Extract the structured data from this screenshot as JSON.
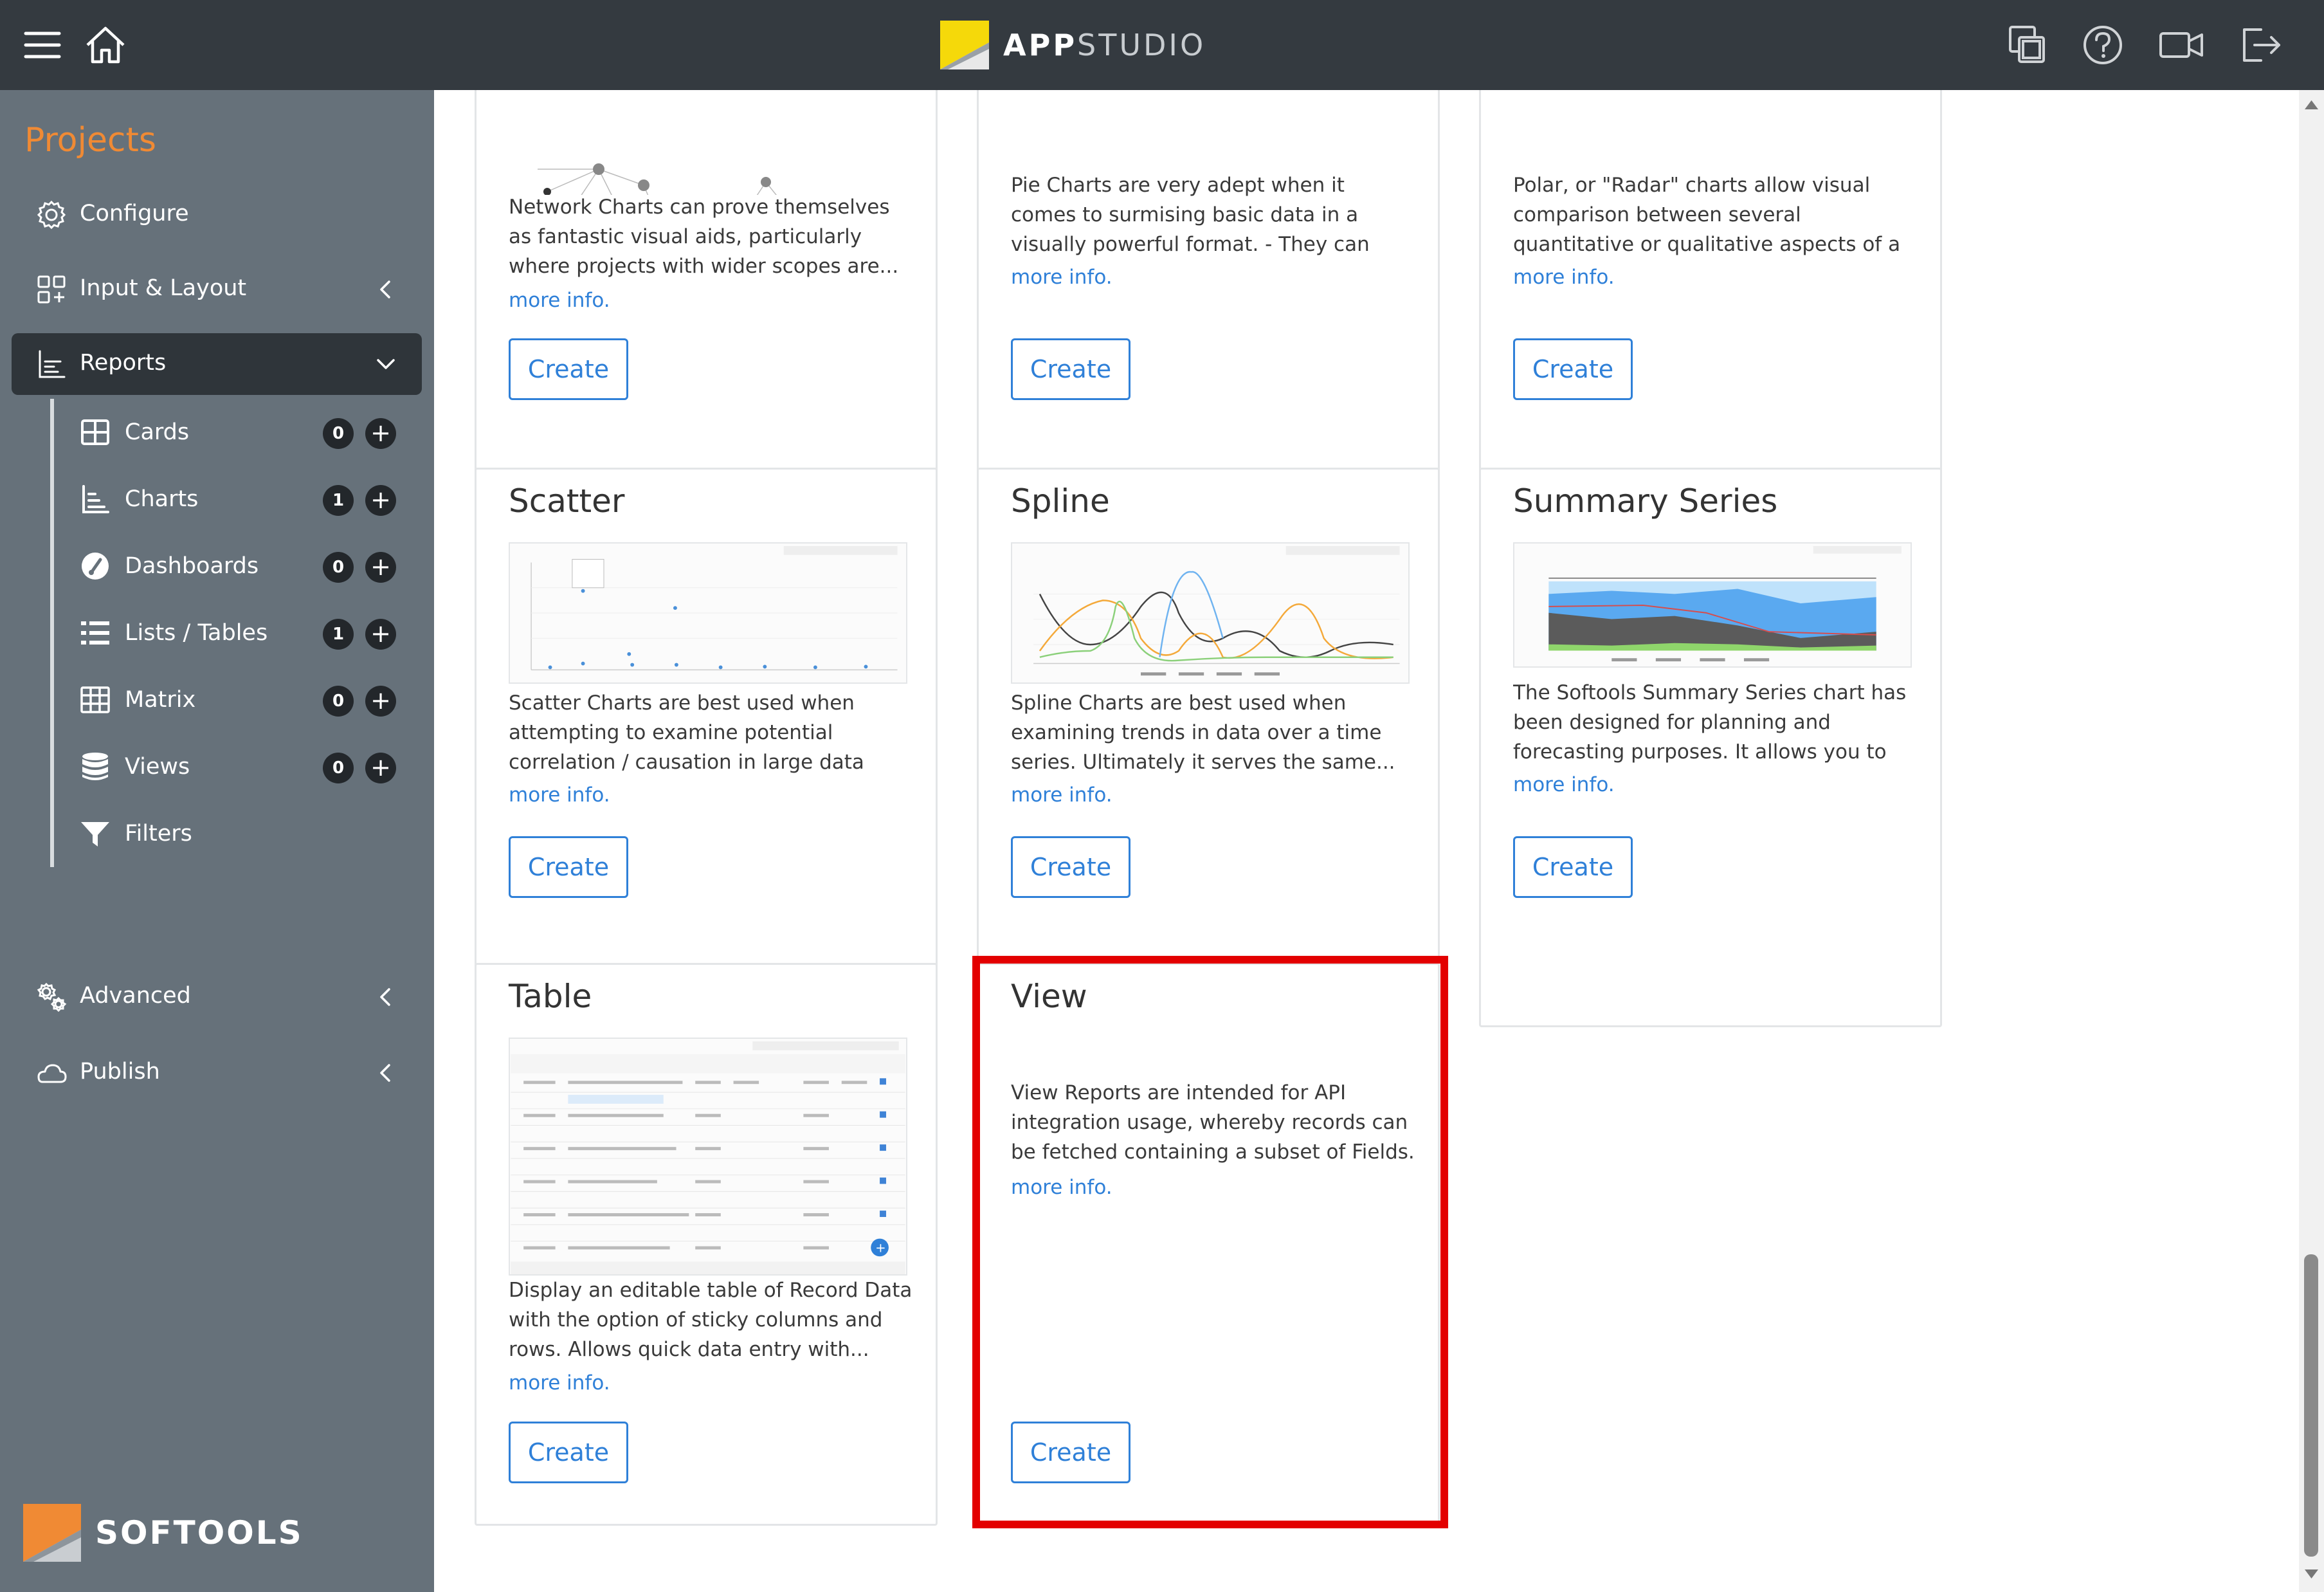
{
  "app": {
    "brand_bold": "APP",
    "brand_light": "STUDIO",
    "footer_brand": "SOFTOOLS",
    "accent_color": "#f08a34",
    "link_color": "#2f80d8",
    "highlight_color": "#e30000"
  },
  "topbar": {
    "left_icons": [
      "hamburger-menu-icon",
      "home-icon"
    ],
    "right_icons": [
      "copy-window-icon",
      "help-icon",
      "video-icon",
      "logout-icon"
    ]
  },
  "sidebar": {
    "title": "Projects",
    "items": [
      {
        "label": "Configure",
        "icon": "gear-icon"
      },
      {
        "label": "Input & Layout",
        "icon": "layout-grid-icon"
      },
      {
        "label": "Reports",
        "icon": "chart-icon"
      },
      {
        "label": "Advanced",
        "icon": "gears-icon"
      },
      {
        "label": "Publish",
        "icon": "cloud-icon"
      }
    ],
    "reports_children": [
      {
        "label": "Cards",
        "count": "0",
        "icon": "cards-icon"
      },
      {
        "label": "Charts",
        "count": "1",
        "icon": "chart-icon"
      },
      {
        "label": "Dashboards",
        "count": "0",
        "icon": "dashboard-gauge-icon"
      },
      {
        "label": "Lists / Tables",
        "count": "1",
        "icon": "list-icon"
      },
      {
        "label": "Matrix",
        "count": "0",
        "icon": "matrix-icon"
      },
      {
        "label": "Views",
        "count": "0",
        "icon": "database-icon"
      },
      {
        "label": "Filters",
        "icon": "filter-icon"
      }
    ],
    "add_symbol": "+"
  },
  "cards": [
    {
      "title": "",
      "desc": "Network Charts can prove themselves as fantastic visual aids, particularly where projects with wider scopes are...",
      "more": "more info.",
      "button": "Create"
    },
    {
      "title": "",
      "desc": "Pie Charts are very adept when it comes to surmising basic data in a visually powerful format. - They can also prove ...",
      "more": "more info.",
      "button": "Create"
    },
    {
      "title": "",
      "desc": "Polar, or \"Radar\" charts allow visual comparison between several quantitative or qualitative aspects of a scenario.Or...",
      "more": "more info.",
      "button": "Create"
    },
    {
      "title": "Scatter",
      "desc": "Scatter Charts are best used when attempting to examine potential correlation / causation in large data set...",
      "more": "more info.",
      "button": "Create"
    },
    {
      "title": "Spline",
      "desc": "Spline Charts are best used when examining trends in data over a time series. Ultimately it serves the same...",
      "more": "more info.",
      "button": "Create"
    },
    {
      "title": "Summary Series",
      "desc": "The Softools Summary Series chart has been designed for planning and forecasting purposes. It allows you to pl...",
      "more": "more info.",
      "button": "Create"
    },
    {
      "title": "Table",
      "desc": "Display an editable table of Record Data with the option of sticky columns and rows. Allows quick data entry with...",
      "more": "more info.",
      "button": "Create"
    },
    {
      "title": "View",
      "desc": "View Reports are intended for API integration usage, whereby records can be fetched containing a subset of Fields.",
      "more": "more info.",
      "button": "Create"
    }
  ]
}
